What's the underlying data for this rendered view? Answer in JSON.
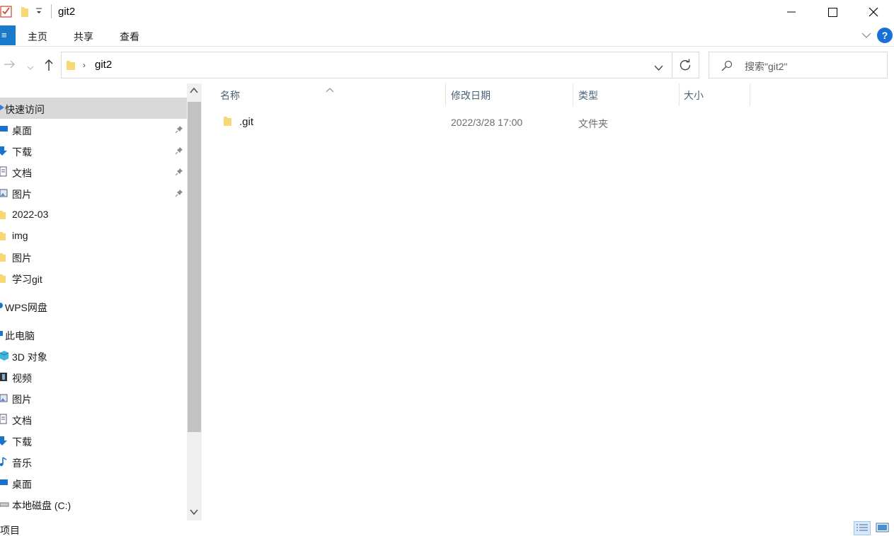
{
  "window": {
    "title": "git2"
  },
  "ribbon": {
    "tabs": [
      "主页",
      "共享",
      "查看"
    ],
    "help_label": "?"
  },
  "navigation": {
    "breadcrumb": "git2",
    "search_placeholder": "搜索\"git2\""
  },
  "sidebar": {
    "items": [
      {
        "label": "快速访问",
        "icon": "star-icon",
        "pinned": false,
        "selected": true
      },
      {
        "label": "桌面",
        "icon": "desktop-icon",
        "pinned": true
      },
      {
        "label": "下载",
        "icon": "download-icon",
        "pinned": true
      },
      {
        "label": "文档",
        "icon": "document-icon",
        "pinned": true
      },
      {
        "label": "图片",
        "icon": "picture-icon",
        "pinned": true
      },
      {
        "label": "2022-03",
        "icon": "folder-icon",
        "pinned": false
      },
      {
        "label": "img",
        "icon": "folder-icon",
        "pinned": false
      },
      {
        "label": "图片",
        "icon": "folder-icon",
        "pinned": false
      },
      {
        "label": "学习git",
        "icon": "folder-icon",
        "pinned": false
      },
      {
        "label": "WPS网盘",
        "icon": "cloud-icon",
        "pinned": false
      },
      {
        "label": "此电脑",
        "icon": "computer-icon",
        "pinned": false
      },
      {
        "label": "3D 对象",
        "icon": "cube-icon",
        "pinned": false
      },
      {
        "label": "视频",
        "icon": "video-icon",
        "pinned": false
      },
      {
        "label": "图片",
        "icon": "picture-icon",
        "pinned": false
      },
      {
        "label": "文档",
        "icon": "document-icon",
        "pinned": false
      },
      {
        "label": "下载",
        "icon": "download-icon",
        "pinned": false
      },
      {
        "label": "音乐",
        "icon": "music-icon",
        "pinned": false
      },
      {
        "label": "桌面",
        "icon": "desktop-icon",
        "pinned": false
      },
      {
        "label": "本地磁盘 (C:)",
        "icon": "drive-icon",
        "pinned": false
      }
    ]
  },
  "file_list": {
    "columns": [
      "名称",
      "修改日期",
      "类型",
      "大小"
    ],
    "rows": [
      {
        "name": ".git",
        "modified": "2022/3/28 17:00",
        "type": "文件夹",
        "size": ""
      }
    ]
  },
  "status_bar": {
    "text": "项目"
  },
  "colors": {
    "accent": "#1979ca",
    "folder": "#f8d775",
    "selected_bg": "#d9d9d9",
    "header_text": "#4c607a"
  }
}
